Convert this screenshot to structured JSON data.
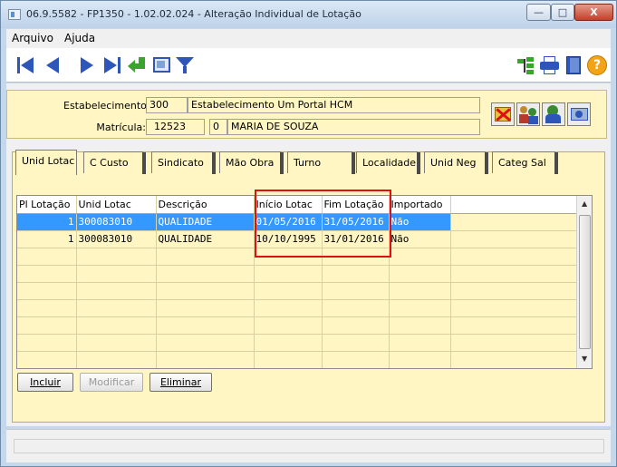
{
  "window": {
    "title": "06.9.5582 - FP1350 - 1.02.02.024 - Alteração Individual de Lotação",
    "minimize_symbol": "—",
    "maximize_symbol": "□",
    "close_symbol": "X"
  },
  "menu": [
    {
      "label": "Arquivo"
    },
    {
      "label": "Ajuda"
    }
  ],
  "toolbar": {
    "nav_icons": [
      "first-record-icon",
      "previous-record-icon",
      "next-record-icon",
      "last-record-icon",
      "return-icon",
      "preview-icon",
      "filter-icon"
    ],
    "right_icons": [
      "tree-icon",
      "printer-icon",
      "exit-door-icon",
      "help-icon"
    ],
    "help_symbol": "?"
  },
  "header": {
    "estabelecimento_label": "Estabelecimento:",
    "estabelecimento_code": "300",
    "estabelecimento_name": "Estabelecimento Um Portal HCM",
    "matricula_label": "Matrícula:",
    "matricula_code": "12523",
    "matricula_digit": "0",
    "matricula_name": "MARIA DE SOUZA"
  },
  "tabs": [
    {
      "label": "Unid Lotac",
      "active": true
    },
    {
      "label": "C Custo"
    },
    {
      "label": "Sindicato"
    },
    {
      "label": "Mão Obra"
    },
    {
      "label": "Turno"
    },
    {
      "label": "Localidade"
    },
    {
      "label": "Unid Neg"
    },
    {
      "label": "Categ Sal"
    }
  ],
  "grid": {
    "columns": [
      "Pl Lotação",
      "Unid Lotac",
      "Descrição",
      "Início Lotac",
      "Fim Lotação",
      "Importado"
    ],
    "rows": [
      [
        "1",
        "300083010",
        "QUALIDADE",
        "01/05/2016",
        "31/05/2016",
        "Não"
      ],
      [
        "1",
        "300083010",
        "QUALIDADE",
        "10/10/1995",
        "31/01/2016",
        "Não"
      ]
    ],
    "empty_rows": 7,
    "scroll_up": "▲",
    "scroll_down": "▼"
  },
  "buttons": {
    "incluir": "Incluir",
    "modificar": "Modificar",
    "eliminar": "Eliminar"
  },
  "colors": {
    "field_background": "#fff6c4",
    "selection": "#3399ff",
    "highlight_box": "#e01010"
  }
}
